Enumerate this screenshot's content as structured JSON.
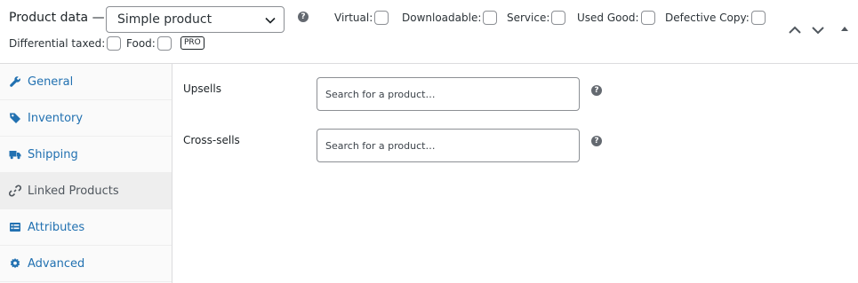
{
  "header": {
    "title": "Product data —",
    "product_type": "Simple product",
    "options": {
      "virtual": "Virtual:",
      "downloadable": "Downloadable:",
      "service": "Service:",
      "used_good": "Used Good:",
      "defective_copy": "Defective Copy:",
      "differential_taxed": "Differential taxed:",
      "food": "Food:"
    },
    "pro_badge": "PRO",
    "help_glyph": "?"
  },
  "tabs": [
    {
      "label": "General",
      "icon": "wrench-icon"
    },
    {
      "label": "Inventory",
      "icon": "tag-icon"
    },
    {
      "label": "Shipping",
      "icon": "truck-icon"
    },
    {
      "label": "Linked Products",
      "icon": "link-icon",
      "active": true
    },
    {
      "label": "Attributes",
      "icon": "list-icon"
    },
    {
      "label": "Advanced",
      "icon": "gear-icon"
    }
  ],
  "linked": {
    "upsells_label": "Upsells",
    "upsells_placeholder": "Search for a product…",
    "crosssells_label": "Cross-sells",
    "crosssells_placeholder": "Search for a product…"
  },
  "colors": {
    "link": "#2271b1",
    "active_tab_bg": "#eeeeee",
    "border": "#dcdcde"
  }
}
